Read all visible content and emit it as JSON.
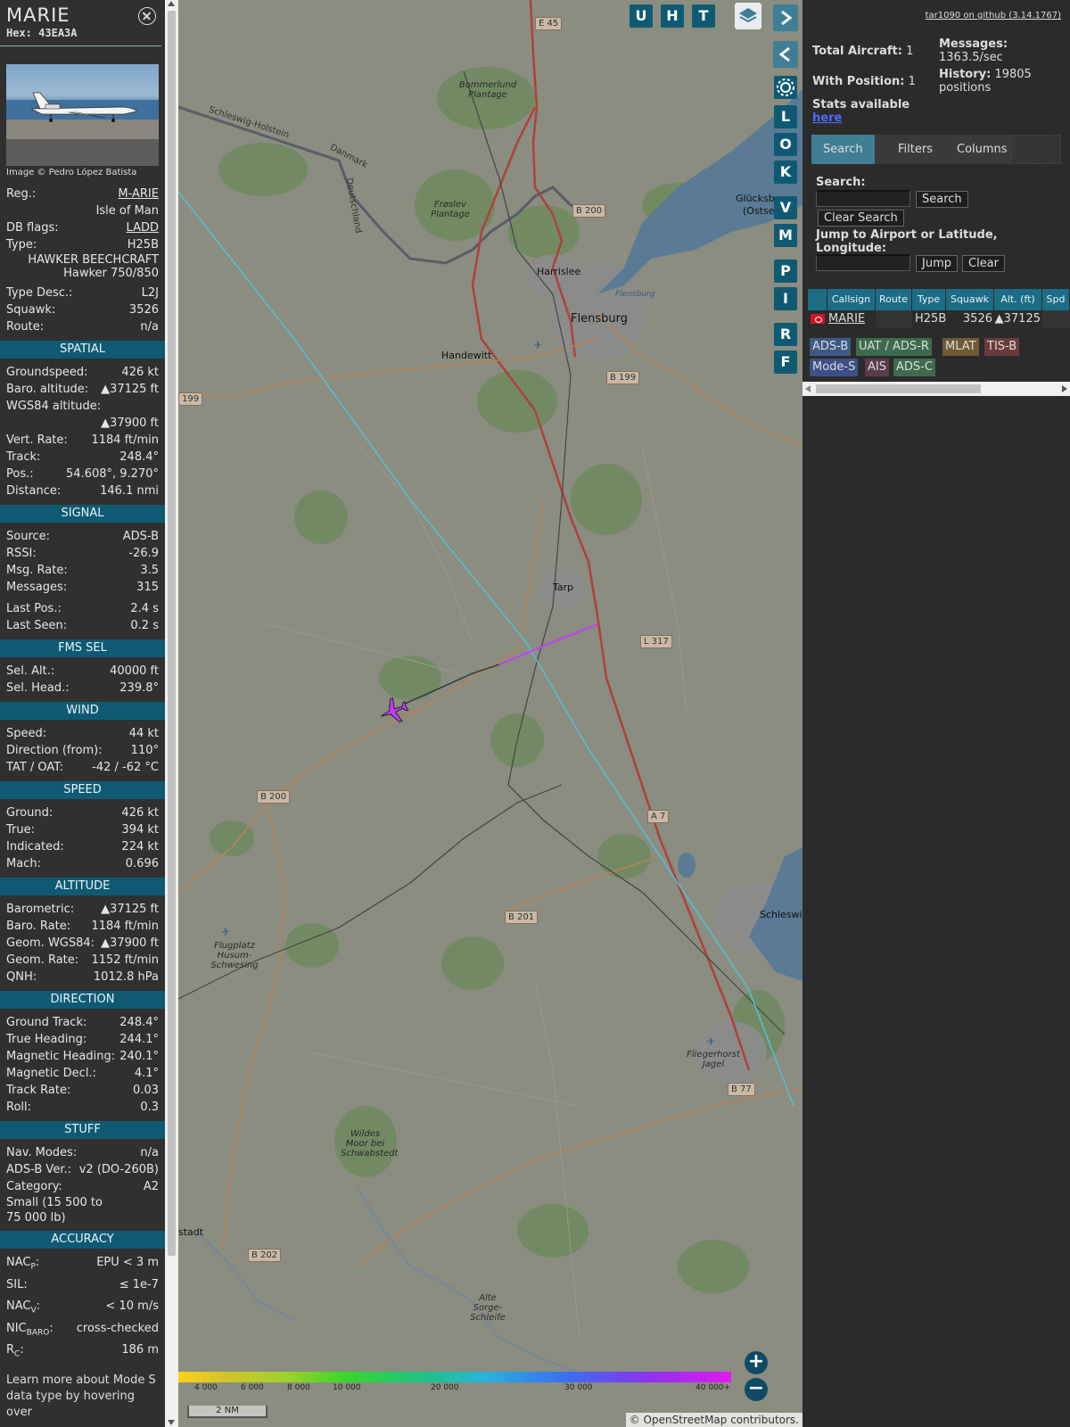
{
  "info": {
    "callsign": "MARIE",
    "hex_label": "Hex:",
    "hex": "43EA3A",
    "photo_credit": "Image © Pedro López Batista",
    "reg_label": "Reg.:",
    "reg": "M-ARIE",
    "country": "Isle of Man",
    "dbflags_label": "DB flags:",
    "dbflags": "LADD",
    "type_label": "Type:",
    "type": "H25B",
    "type_full_1": "HAWKER BEECHCRAFT",
    "type_full_2": "Hawker 750/850",
    "typedesc_label": "Type Desc.:",
    "typedesc": "L2J",
    "squawk_label": "Squawk:",
    "squawk": "3526",
    "route_label": "Route:",
    "route": "n/a"
  },
  "sections": {
    "spatial": "SPATIAL",
    "signal": "SIGNAL",
    "fms": "FMS SEL",
    "wind": "WIND",
    "speed": "SPEED",
    "altitude": "ALTITUDE",
    "direction": "DIRECTION",
    "stuff": "STUFF",
    "accuracy": "ACCURACY"
  },
  "spatial": [
    {
      "label": "Groundspeed:",
      "value": "426 kt"
    },
    {
      "label": "Baro. altitude:",
      "value": "▲37125 ft"
    },
    {
      "label": "WGS84 altitude:",
      "value": ""
    },
    {
      "label": "",
      "value": "▲37900 ft"
    },
    {
      "label": "Vert. Rate:",
      "value": "1184 ft/min"
    },
    {
      "label": "Track:",
      "value": "248.4°"
    },
    {
      "label": "Pos.:",
      "value": "54.608°, 9.270°"
    },
    {
      "label": "Distance:",
      "value": "146.1 nmi"
    }
  ],
  "signal": [
    {
      "label": "Source:",
      "value": "ADS-B"
    },
    {
      "label": "RSSI:",
      "value": "-26.9"
    },
    {
      "label": "Msg. Rate:",
      "value": "3.5"
    },
    {
      "label": "Messages:",
      "value": "315"
    },
    {
      "label": "Last Pos.:",
      "value": "2.4 s"
    },
    {
      "label": "Last Seen:",
      "value": "0.2 s"
    }
  ],
  "fms": [
    {
      "label": "Sel. Alt.:",
      "value": "40000 ft"
    },
    {
      "label": "Sel. Head.:",
      "value": "239.8°"
    }
  ],
  "wind": [
    {
      "label": "Speed:",
      "value": "44 kt"
    },
    {
      "label": "Direction (from):",
      "value": "110°"
    },
    {
      "label": "TAT / OAT:",
      "value": "-42 / -62 °C"
    }
  ],
  "speed": [
    {
      "label": "Ground:",
      "value": "426 kt"
    },
    {
      "label": "True:",
      "value": "394 kt"
    },
    {
      "label": "Indicated:",
      "value": "224 kt"
    },
    {
      "label": "Mach:",
      "value": "0.696"
    }
  ],
  "altitude": [
    {
      "label": "Barometric:",
      "value": "▲37125 ft"
    },
    {
      "label": "Baro. Rate:",
      "value": "1184 ft/min"
    },
    {
      "label": "Geom. WGS84:",
      "value": "▲37900 ft"
    },
    {
      "label": "Geom. Rate:",
      "value": "1152 ft/min"
    },
    {
      "label": "QNH:",
      "value": "1012.8 hPa"
    }
  ],
  "direction": [
    {
      "label": "Ground Track:",
      "value": "248.4°"
    },
    {
      "label": "True Heading:",
      "value": "244.1°"
    },
    {
      "label": "Magnetic Heading:",
      "value": "240.1°"
    },
    {
      "label": "Magnetic Decl.:",
      "value": "4.1°"
    },
    {
      "label": "Track Rate:",
      "value": "0.03"
    },
    {
      "label": "Roll:",
      "value": "0.3"
    }
  ],
  "stuff": [
    {
      "label": "Nav. Modes:",
      "value": "n/a"
    },
    {
      "label": "ADS-B Ver.:",
      "value": "v2 (DO-260B)"
    },
    {
      "label": "Category:",
      "value": "A2"
    }
  ],
  "stuff_category_desc": "Small (15 500 to 75 000 lb)",
  "accuracy": [
    {
      "label": "NAC",
      "sub": "P",
      "post": ":",
      "value": "EPU < 3 m"
    },
    {
      "label": "SIL:",
      "sub": "",
      "post": "",
      "value": "≤ 1e-7"
    },
    {
      "label": "NAC",
      "sub": "V",
      "post": ":",
      "value": "< 10 m/s"
    },
    {
      "label": "NIC",
      "sub": "BARO",
      "post": ":",
      "value": "cross-checked"
    },
    {
      "label": "R",
      "sub": "C",
      "post": ":",
      "value": "186 m"
    }
  ],
  "footer_note": "Learn more about Mode S data type by hovering over",
  "map": {
    "buttons_top": [
      "U",
      "H",
      "T"
    ],
    "side_buttons": [
      "L",
      "O",
      "K",
      "V",
      "M",
      "P",
      "I",
      "R",
      "F"
    ],
    "towns": {
      "flensburg": "Flensburg",
      "harrislee": "Harrislee",
      "handewitt": "Handewitt",
      "tarp": "Tarp",
      "schleswig": "Schleswi",
      "glucksburg": "Glücksbu",
      "ostsee": "(Ostsee",
      "stadt": "stadt",
      "bommerlund": "Bommerlund Plantage",
      "froslev": "Frøslev Plantage",
      "flensburg_small": "Flensburg",
      "flugplatz": "Flugplatz Husum-Schwesing",
      "fliegerhorst": "Fliegerhorst Jagel",
      "wildes": "Wildes Moor bei Schwabstedt",
      "altesorge": "Alte Sorge-Schleife",
      "schleswig_holstein": "Schleswig-Holstein",
      "danmark": "Danmark",
      "deutschland": "Deutschland"
    },
    "roads": {
      "e45": "E 45",
      "b200a": "B 200",
      "b199a": "B 199",
      "b199b": "199",
      "l317": "L 317",
      "b200b": "B 200",
      "a7": "A 7",
      "b201": "B 201",
      "b77": "B 77",
      "b202": "B 202"
    },
    "alt_scale": [
      "4 000",
      "6 000",
      "8 000",
      "10 000",
      "20 000",
      "30 000",
      "40 000+"
    ],
    "scale_bar": "2 NM",
    "osm_credit": "© OpenStreetMap contributors."
  },
  "right": {
    "github": "tar1090 on github (3.14.1767)",
    "total_aircraft_label": "Total Aircraft:",
    "total_aircraft": "1",
    "with_position_label": "With Position:",
    "with_position": "1",
    "messages_label": "Messages:",
    "messages": "1363.5/sec",
    "history_label": "History:",
    "history": "19805 positions",
    "stats_label": "Stats available",
    "stats_link": "here",
    "tabs": [
      "Search",
      "Filters",
      "Columns"
    ],
    "search_label": "Search:",
    "search_button": "Search",
    "clear_search_button": "Clear Search",
    "jump_label": "Jump to Airport or Latitude, Longitude:",
    "jump_button": "Jump",
    "clear_button": "Clear",
    "table_headers": [
      "Callsign",
      "Route",
      "Type",
      "Squawk",
      "Alt. (ft)",
      "Spd"
    ],
    "table_row": {
      "callsign": "MARIE",
      "route": "",
      "type": "H25B",
      "squawk": "3526",
      "alt": "▲37125"
    },
    "legend": [
      {
        "label": "ADS-B",
        "color": "#3c5a86"
      },
      {
        "label": "UAT / ADS-R",
        "color": "#3d6b4d"
      },
      {
        "label": "MLAT",
        "color": "#6f5a35"
      },
      {
        "label": "TIS-B",
        "color": "#6b3a3a"
      },
      {
        "label": "Mode-S",
        "color": "#3c4f86"
      },
      {
        "label": "AIS",
        "color": "#5a3c4a"
      },
      {
        "label": "ADS-C",
        "color": "#3d6b4d"
      }
    ]
  }
}
